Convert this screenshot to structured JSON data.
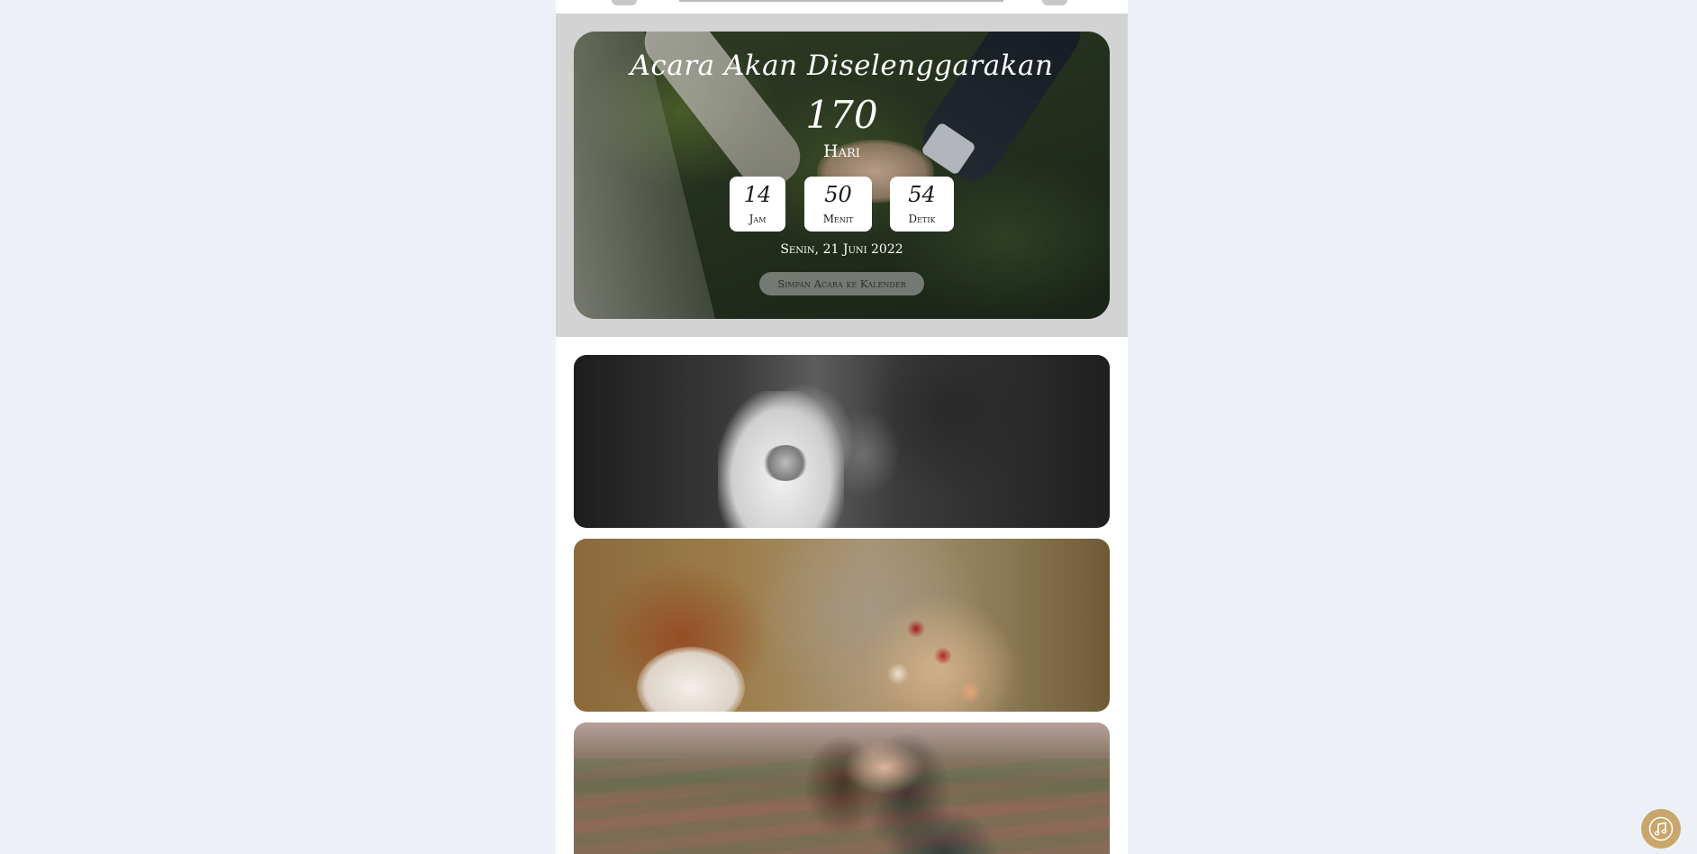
{
  "countdown": {
    "title": "Acara Akan Diselenggarakan",
    "days": "170",
    "days_label": "Hari",
    "hours": "14",
    "hours_label": "Jam",
    "minutes": "50",
    "minutes_label": "Menit",
    "seconds": "54",
    "seconds_label": "Detik",
    "event_date": "Senin, 21 Juni 2022",
    "save_calendar_label": "Simpan Acara ke Kalender"
  },
  "colors": {
    "page_background": "#edf1f7",
    "band_background": "#d3d3d3",
    "music_button": "#c9a66b"
  },
  "icons": {
    "music": "music-note-icon"
  }
}
